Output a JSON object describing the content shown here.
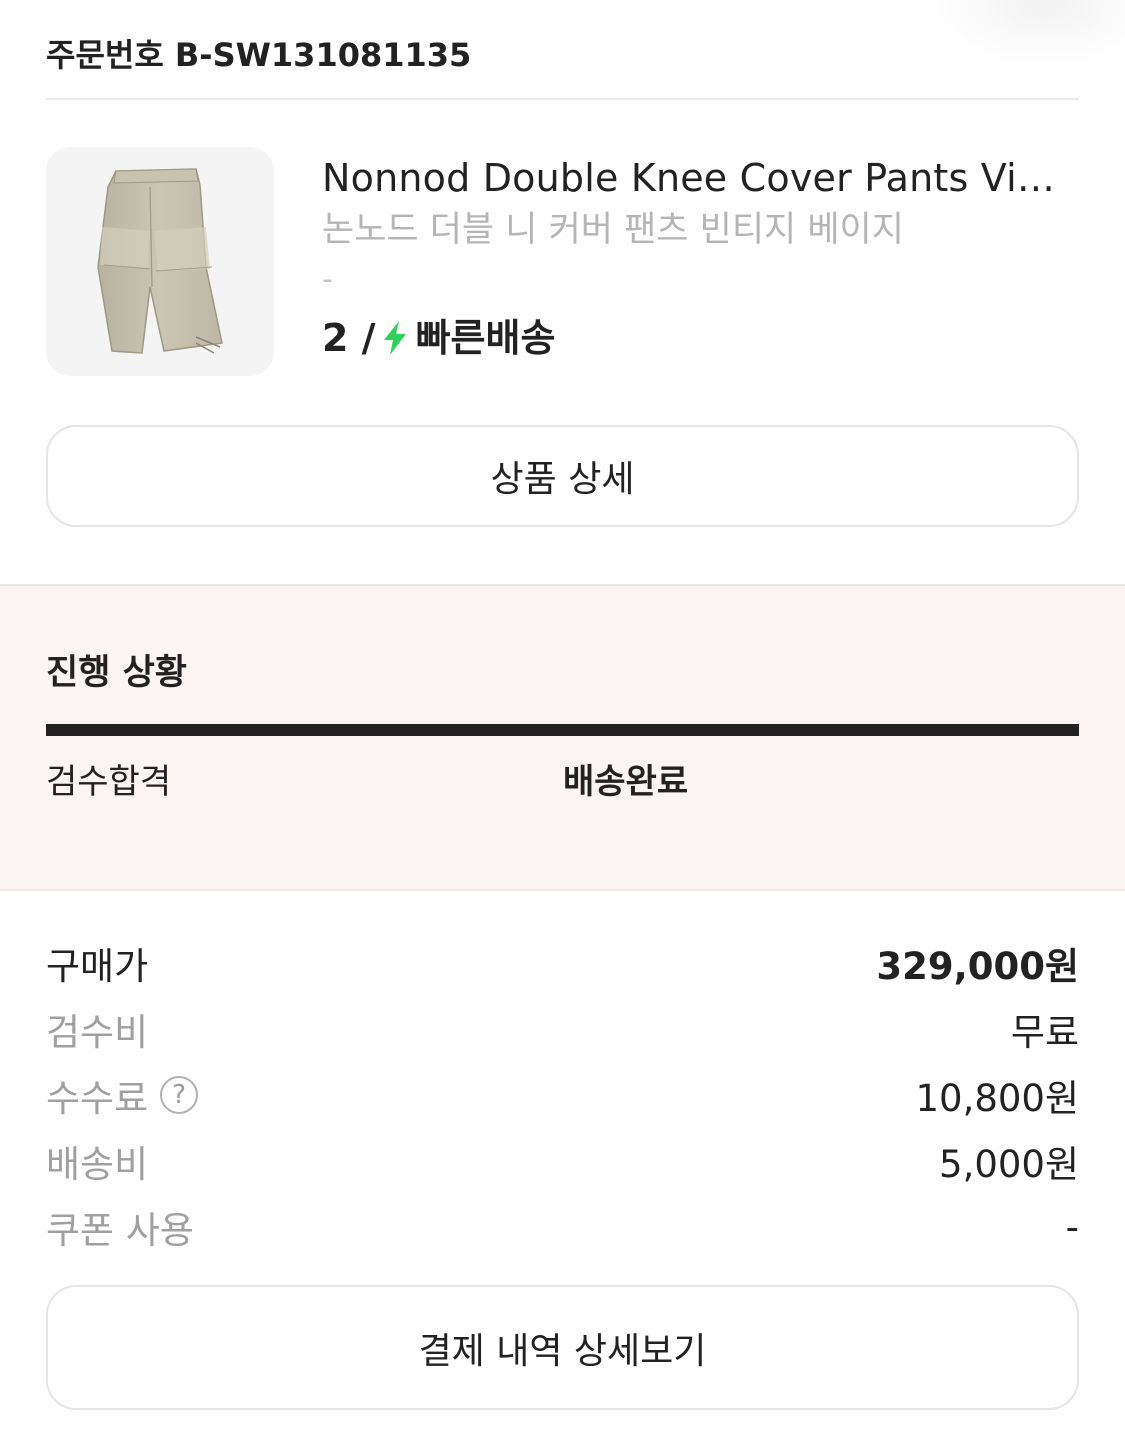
{
  "order": {
    "number_label": "주문번호 B-SW131081135"
  },
  "product": {
    "name_en": "Nonnod Double Knee Cover Pants Vint...",
    "name_ko": "논노드 더블 니 커버 팬츠 빈티지 베이지",
    "option": "-",
    "size_prefix": "2 /",
    "delivery_type": "빠른배송",
    "image_icon": "pants-image"
  },
  "buttons": {
    "product_detail": "상품 상세",
    "payment_detail": "결제 내역 상세보기"
  },
  "progress": {
    "title": "진행 상황",
    "steps": [
      "검수합격",
      "배송완료"
    ],
    "current_step": "배송완료"
  },
  "prices": [
    {
      "label": "구매가",
      "value": "329,000원"
    },
    {
      "label": "검수비",
      "value": "무료"
    },
    {
      "label": "수수료",
      "value": "10,800원"
    },
    {
      "label": "배송비",
      "value": "5,000원"
    },
    {
      "label": "쿠폰 사용",
      "value": "-"
    }
  ],
  "colors": {
    "accent_green": "#2fd15a",
    "progress_bg": "#faf4f3",
    "text_primary": "#222222",
    "text_muted": "#a0a0a0"
  }
}
